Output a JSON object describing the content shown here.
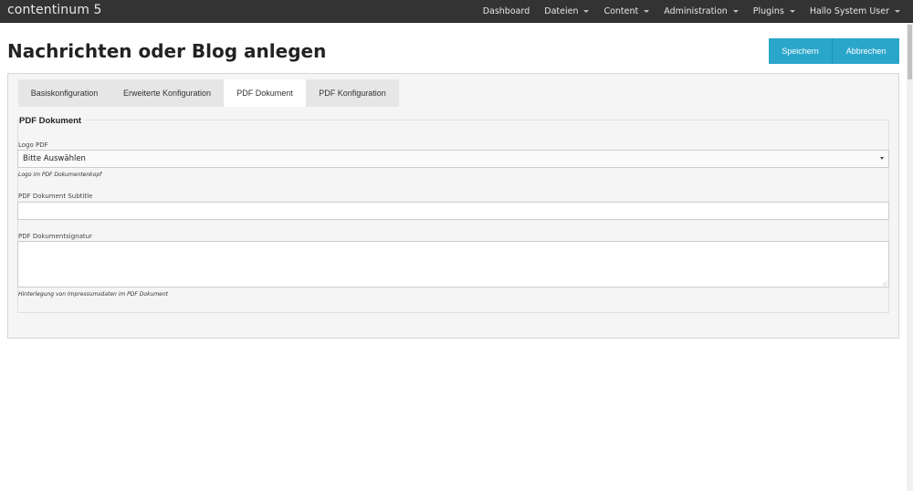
{
  "navbar": {
    "brand": "contentinum 5",
    "items": [
      {
        "label": "Dashboard",
        "dropdown": false
      },
      {
        "label": "Dateien",
        "dropdown": true
      },
      {
        "label": "Content",
        "dropdown": true
      },
      {
        "label": "Administration",
        "dropdown": true
      },
      {
        "label": "Plugins",
        "dropdown": true
      },
      {
        "label": "Hallo System User",
        "dropdown": true
      }
    ]
  },
  "page": {
    "title": "Nachrichten oder Blog anlegen",
    "save_label": "Speichern",
    "cancel_label": "Abbrechen"
  },
  "tabs": [
    {
      "label": "Basiskonfiguration",
      "active": false
    },
    {
      "label": "Erweiterte Konfiguration",
      "active": false
    },
    {
      "label": "PDF Dokument",
      "active": true
    },
    {
      "label": "PDF Konfiguration",
      "active": false
    }
  ],
  "form": {
    "legend": "PDF Dokument",
    "logo_label": "Logo PDF",
    "logo_value": "Bitte Auswählen",
    "logo_help": "Logo im PDF Dokumentenkopf",
    "subtitle_label": "PDF Dokument Subtitle",
    "subtitle_value": "",
    "signature_label": "PDF Dokumentsignatur",
    "signature_value": "",
    "signature_help": "Hinterlegung von Impressumsdaten im PDF Dokument"
  },
  "colors": {
    "navbar_bg": "#333333",
    "button_bg": "#2ba6cb",
    "panel_bg": "#f5f5f5"
  }
}
